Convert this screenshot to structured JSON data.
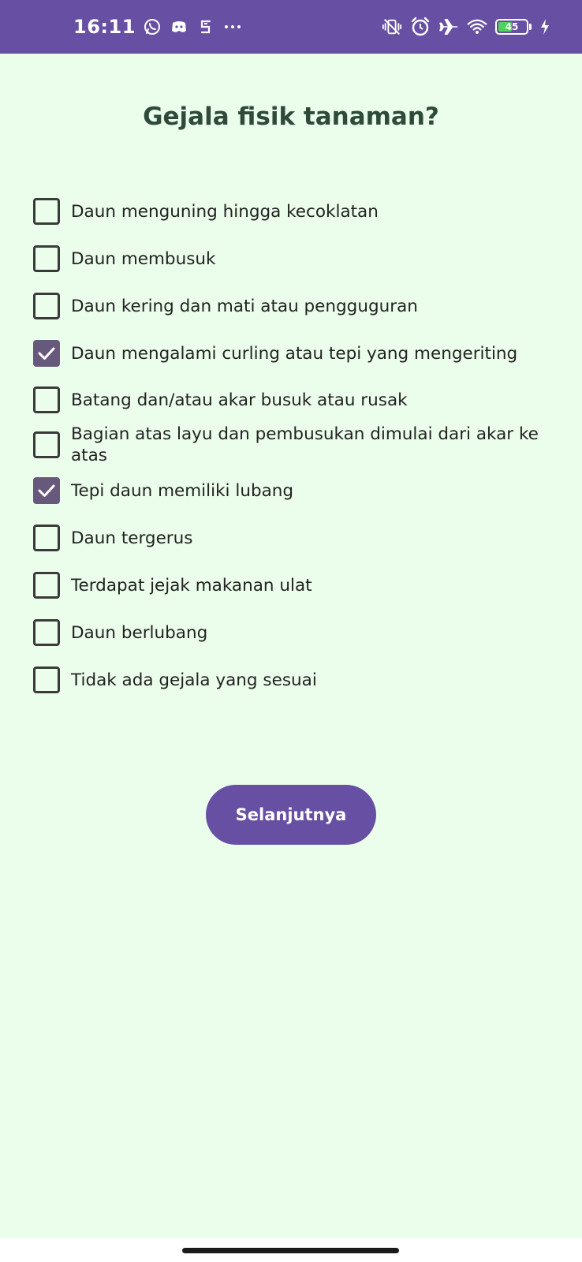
{
  "status_bar": {
    "time": "16:11",
    "battery_level": "45",
    "battery_percent": 45,
    "left_icons": [
      "whatsapp-icon",
      "discord-icon",
      "app-icon",
      "more-notifications-icon"
    ],
    "right_icons": [
      "vibrate-off-icon",
      "alarm-icon",
      "airplane-icon",
      "wifi-icon",
      "battery-icon",
      "charging-icon"
    ],
    "color": "#6750a4"
  },
  "page": {
    "title": "Gejala fisik tanaman?",
    "background": "#ebfdeb"
  },
  "symptoms": [
    {
      "label": "Daun menguning hingga kecoklatan",
      "checked": false
    },
    {
      "label": "Daun membusuk",
      "checked": false
    },
    {
      "label": "Daun kering dan mati atau pengguguran",
      "checked": false
    },
    {
      "label": "Daun mengalami curling atau tepi yang mengeriting",
      "checked": true
    },
    {
      "label": "Batang dan/atau akar busuk atau rusak",
      "checked": false
    },
    {
      "label": "Bagian atas layu dan pembusukan dimulai dari akar ke atas",
      "checked": false
    },
    {
      "label": "Tepi daun memiliki lubang",
      "checked": true
    },
    {
      "label": "Daun tergerus",
      "checked": false
    },
    {
      "label": "Terdapat jejak makanan ulat",
      "checked": false
    },
    {
      "label": "Daun berlubang",
      "checked": false
    },
    {
      "label": "Tidak ada gejala yang sesuai",
      "checked": false
    }
  ],
  "next_button": {
    "label": "Selanjutnya",
    "color": "#6750a4"
  },
  "checkbox_checked_color": "#67597b"
}
